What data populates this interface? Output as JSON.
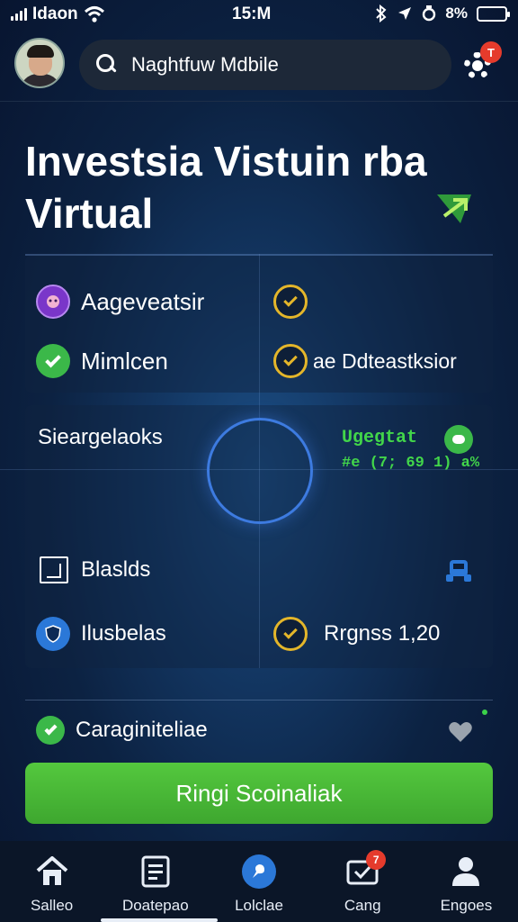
{
  "status_bar": {
    "carrier": "Idaon",
    "time": "15:M",
    "battery_text": "8%",
    "battery_level_fraction": 0.86
  },
  "header": {
    "search_value": "Naghtfuw Mdbile",
    "notification_count": "T"
  },
  "page_title": "Investsia Vistuin rba Virtual",
  "features": {
    "row1_left": "Aageveatsir",
    "row2_left": "Mimlcen",
    "row2_right": "ae Ddteastksior",
    "row3_left": "Sieargelaoks",
    "stat_label": "Ugegtat",
    "stat_value": "#e (7; 69 1) a%",
    "row4_left": "Blaslds",
    "row5_left": "Ilusbelas",
    "row5_right": "Rrgnss 1,20",
    "footer_item": "Caraginiteliae"
  },
  "cta_button": "Ringi Scoinaliak",
  "bottom_nav": [
    {
      "label": "Salleo",
      "icon": "home-icon"
    },
    {
      "label": "Doatepao",
      "icon": "document-icon"
    },
    {
      "label": "Lolclae",
      "icon": "chat-icon"
    },
    {
      "label": "Cang",
      "icon": "inbox-check-icon",
      "badge": "7"
    },
    {
      "label": "Engoes",
      "icon": "profile-icon"
    }
  ],
  "colors": {
    "accent_green": "#3bb849",
    "accent_yellow": "#e4b62a",
    "accent_blue": "#2b78d8",
    "badge_red": "#e53b2c",
    "background": "#0c2242"
  }
}
